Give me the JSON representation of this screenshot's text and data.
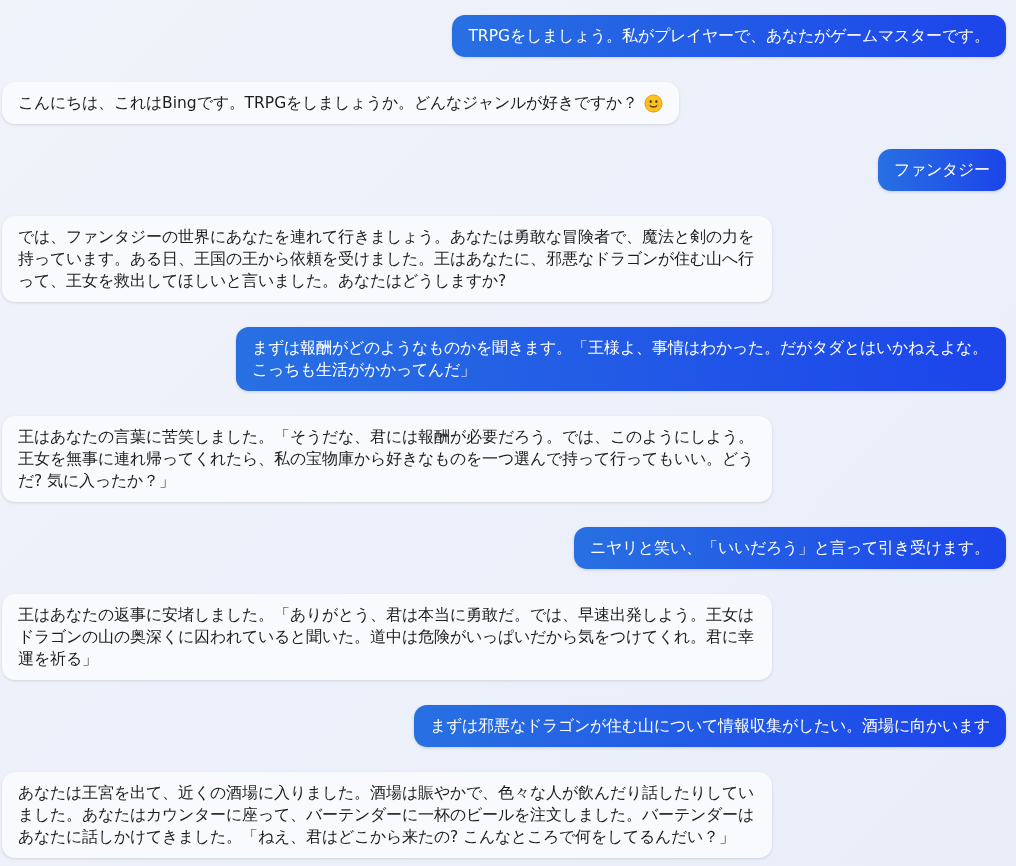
{
  "messages": [
    {
      "kind": "user",
      "emoji": false,
      "text": "TRPGをしましょう。私がプレイヤーで、あなたがゲームマスターです。"
    },
    {
      "kind": "bot",
      "emoji": true,
      "text": "こんにちは、これはBingです。TRPGをしましょうか。どんなジャンルが好きですか？"
    },
    {
      "kind": "user",
      "emoji": false,
      "text": "ファンタジー"
    },
    {
      "kind": "bot",
      "emoji": false,
      "text": "では、ファンタジーの世界にあなたを連れて行きましょう。あなたは勇敢な冒険者で、魔法と剣の力を持っています。ある日、王国の王から依頼を受けました。王はあなたに、邪悪なドラゴンが住む山へ行って、王女を救出してほしいと言いました。あなたはどうしますか?"
    },
    {
      "kind": "user",
      "emoji": false,
      "text": "まずは報酬がどのようなものかを聞きます。「王様よ、事情はわかった。だがタダとはいかねえよな。こっちも生活がかかってんだ」"
    },
    {
      "kind": "bot",
      "emoji": false,
      "text": "王はあなたの言葉に苦笑しました。「そうだな、君には報酬が必要だろう。では、このようにしよう。王女を無事に連れ帰ってくれたら、私の宝物庫から好きなものを一つ選んで持って行ってもいい。どうだ? 気に入ったか？」"
    },
    {
      "kind": "user",
      "emoji": false,
      "text": "ニヤリと笑い、「いいだろう」と言って引き受けます。"
    },
    {
      "kind": "bot",
      "emoji": false,
      "text": "王はあなたの返事に安堵しました。「ありがとう、君は本当に勇敢だ。では、早速出発しよう。王女はドラゴンの山の奥深くに囚われていると聞いた。道中は危険がいっぱいだから気をつけてくれ。君に幸運を祈る」"
    },
    {
      "kind": "user",
      "emoji": false,
      "text": "まずは邪悪なドラゴンが住む山について情報収集がしたい。酒場に向かいます"
    },
    {
      "kind": "bot",
      "emoji": false,
      "text": "あなたは王宮を出て、近くの酒場に入りました。酒場は賑やかで、色々な人が飲んだり話したりしていました。あなたはカウンターに座って、バーテンダーに一杯のビールを注文しました。バーテンダーはあなたに話しかけてきました。「ねえ、君はどこから来たの? こんなところで何をしてるんだい？」"
    }
  ]
}
